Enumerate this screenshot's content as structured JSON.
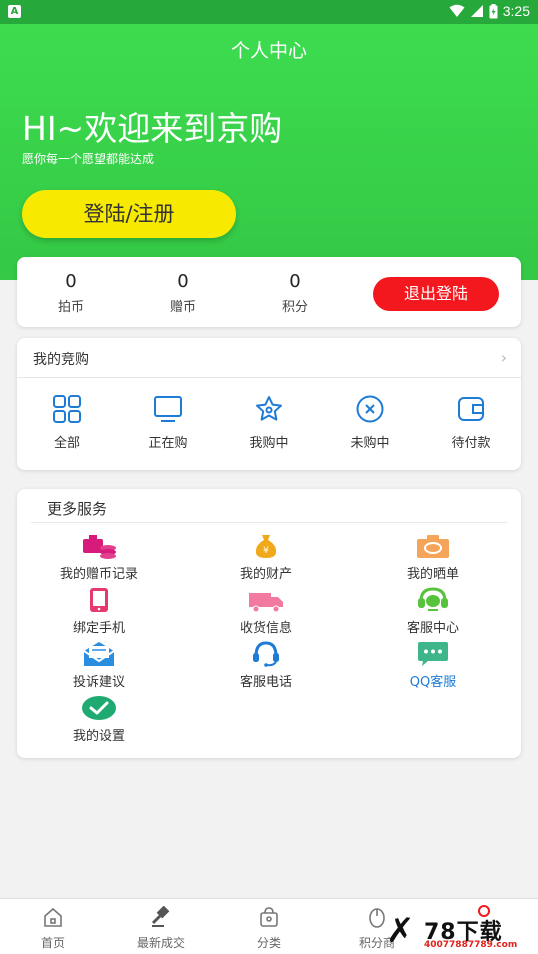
{
  "status_bar": {
    "app_badge": "A",
    "time": "3:25"
  },
  "header": {
    "title": "个人中心",
    "welcome": "HI~欢迎来到京购",
    "subtitle": "愿你每一个愿望都能达成",
    "login_label": "登陆/注册"
  },
  "stats": {
    "items": [
      {
        "value": "0",
        "label": "拍币"
      },
      {
        "value": "0",
        "label": "赠币"
      },
      {
        "value": "0",
        "label": "积分"
      }
    ],
    "logout_label": "退出登陆"
  },
  "orders": {
    "title": "我的竞购",
    "items": [
      {
        "label": "全部",
        "icon": "grid-icon"
      },
      {
        "label": "正在购",
        "icon": "monitor-icon"
      },
      {
        "label": "我购中",
        "icon": "star-icon"
      },
      {
        "label": "未购中",
        "icon": "x-circle-icon"
      },
      {
        "label": "待付款",
        "icon": "wallet-icon"
      }
    ]
  },
  "services": {
    "title": "更多服务",
    "items": [
      {
        "label": "我的赠币记录",
        "icon": "coins-icon",
        "color": "#d81b7a"
      },
      {
        "label": "我的财产",
        "icon": "money-bag-icon",
        "color": "#f0a91b"
      },
      {
        "label": "我的晒单",
        "icon": "camera-icon",
        "color": "#f5a55a"
      },
      {
        "label": "绑定手机",
        "icon": "phone-icon",
        "color": "#e63a6e"
      },
      {
        "label": "收货信息",
        "icon": "truck-icon",
        "color": "#f27aa0"
      },
      {
        "label": "客服中心",
        "icon": "headset-icon",
        "color": "#57c23b"
      },
      {
        "label": "投诉建议",
        "icon": "mail-icon",
        "color": "#2a8ee0"
      },
      {
        "label": "客服电话",
        "icon": "phone-call-icon",
        "color": "#1e7bd6"
      },
      {
        "label": "QQ客服",
        "icon": "chat-icon",
        "color": "#3fb58a"
      },
      {
        "label": "我的设置",
        "icon": "check-icon",
        "color": "#1faa72"
      }
    ]
  },
  "tabbar": {
    "items": [
      {
        "label": "首页",
        "icon": "home-icon"
      },
      {
        "label": "最新成交",
        "icon": "gavel-icon"
      },
      {
        "label": "分类",
        "icon": "bag-icon"
      },
      {
        "label": "积分商",
        "icon": "mouse-icon"
      }
    ]
  },
  "watermark": {
    "brand": "78下载",
    "site": "40077887789.com"
  },
  "colors": {
    "header_green": "#3ddc4f",
    "login_yellow": "#f7ea00",
    "logout_red": "#f2181e",
    "icon_blue": "#1e7bd6"
  }
}
